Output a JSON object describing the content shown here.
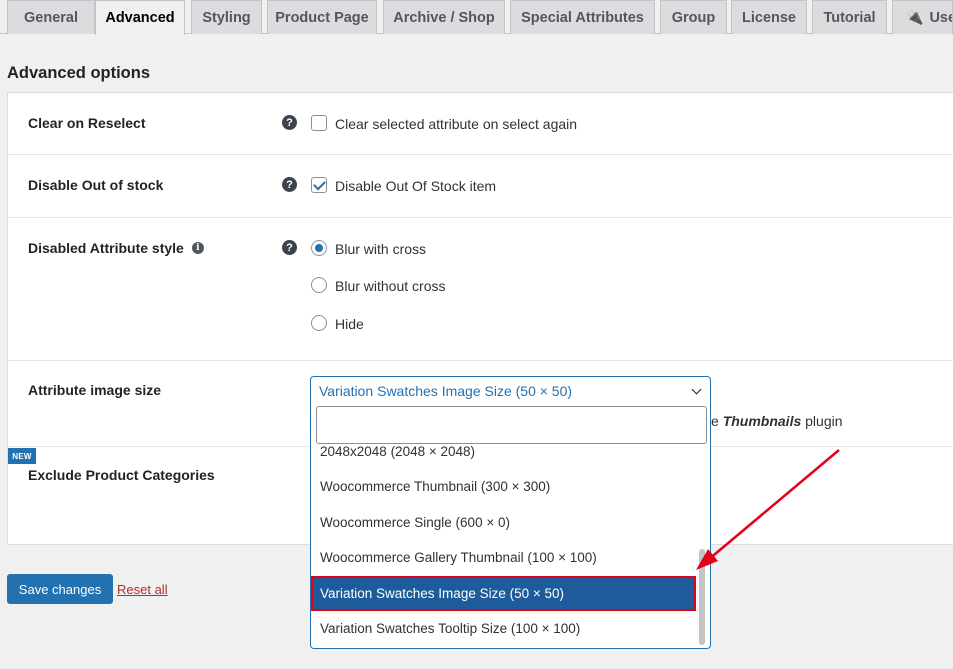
{
  "tabs": [
    {
      "label": "General"
    },
    {
      "label": "Advanced"
    },
    {
      "label": "Styling"
    },
    {
      "label": "Product Page"
    },
    {
      "label": "Archive / Shop"
    },
    {
      "label": "Special Attributes"
    },
    {
      "label": "Group"
    },
    {
      "label": "License"
    },
    {
      "label": "Tutorial"
    },
    {
      "label": "Use"
    }
  ],
  "section_title": "Advanced options",
  "options": {
    "clear_on_reselect": {
      "label": "Clear on Reselect",
      "text": "Clear selected attribute on select again",
      "checked": false
    },
    "disable_out_of_stock": {
      "label": "Disable Out of stock",
      "text": "Disable Out Of Stock item",
      "checked": true
    },
    "disabled_attribute_style": {
      "label": "Disabled Attribute style",
      "choices": [
        "Blur with cross",
        "Blur without cross",
        "Hide"
      ],
      "selected": "Blur with cross"
    },
    "attribute_image_size": {
      "label": "Attribute image size",
      "selected_value": "Variation Swatches Image Size (50 × 50)",
      "note_prefix": "e",
      "note_bold": "Thumbnails",
      "note_suffix": "plugin"
    },
    "exclude_product_categories": {
      "label": "Exclude Product Categories",
      "badge": "NEW"
    }
  },
  "dropdown": {
    "search_placeholder": "",
    "items": [
      "2048x2048 (2048 × 2048)",
      "Woocommerce Thumbnail (300 × 300)",
      "Woocommerce Single (600 × 0)",
      "Woocommerce Gallery Thumbnail (100 × 100)",
      "Variation Swatches Image Size (50 × 50)",
      "Variation Swatches Tooltip Size (100 × 100)"
    ],
    "selected_index": 4
  },
  "footer": {
    "save_label": "Save changes",
    "reset_label": "Reset all"
  },
  "colors": {
    "accent": "#2271b1",
    "selected_bg": "#1e5b9a",
    "highlight": "#e3001b",
    "danger": "#b32d2e"
  },
  "help_icon": "?",
  "info_icon": "i"
}
